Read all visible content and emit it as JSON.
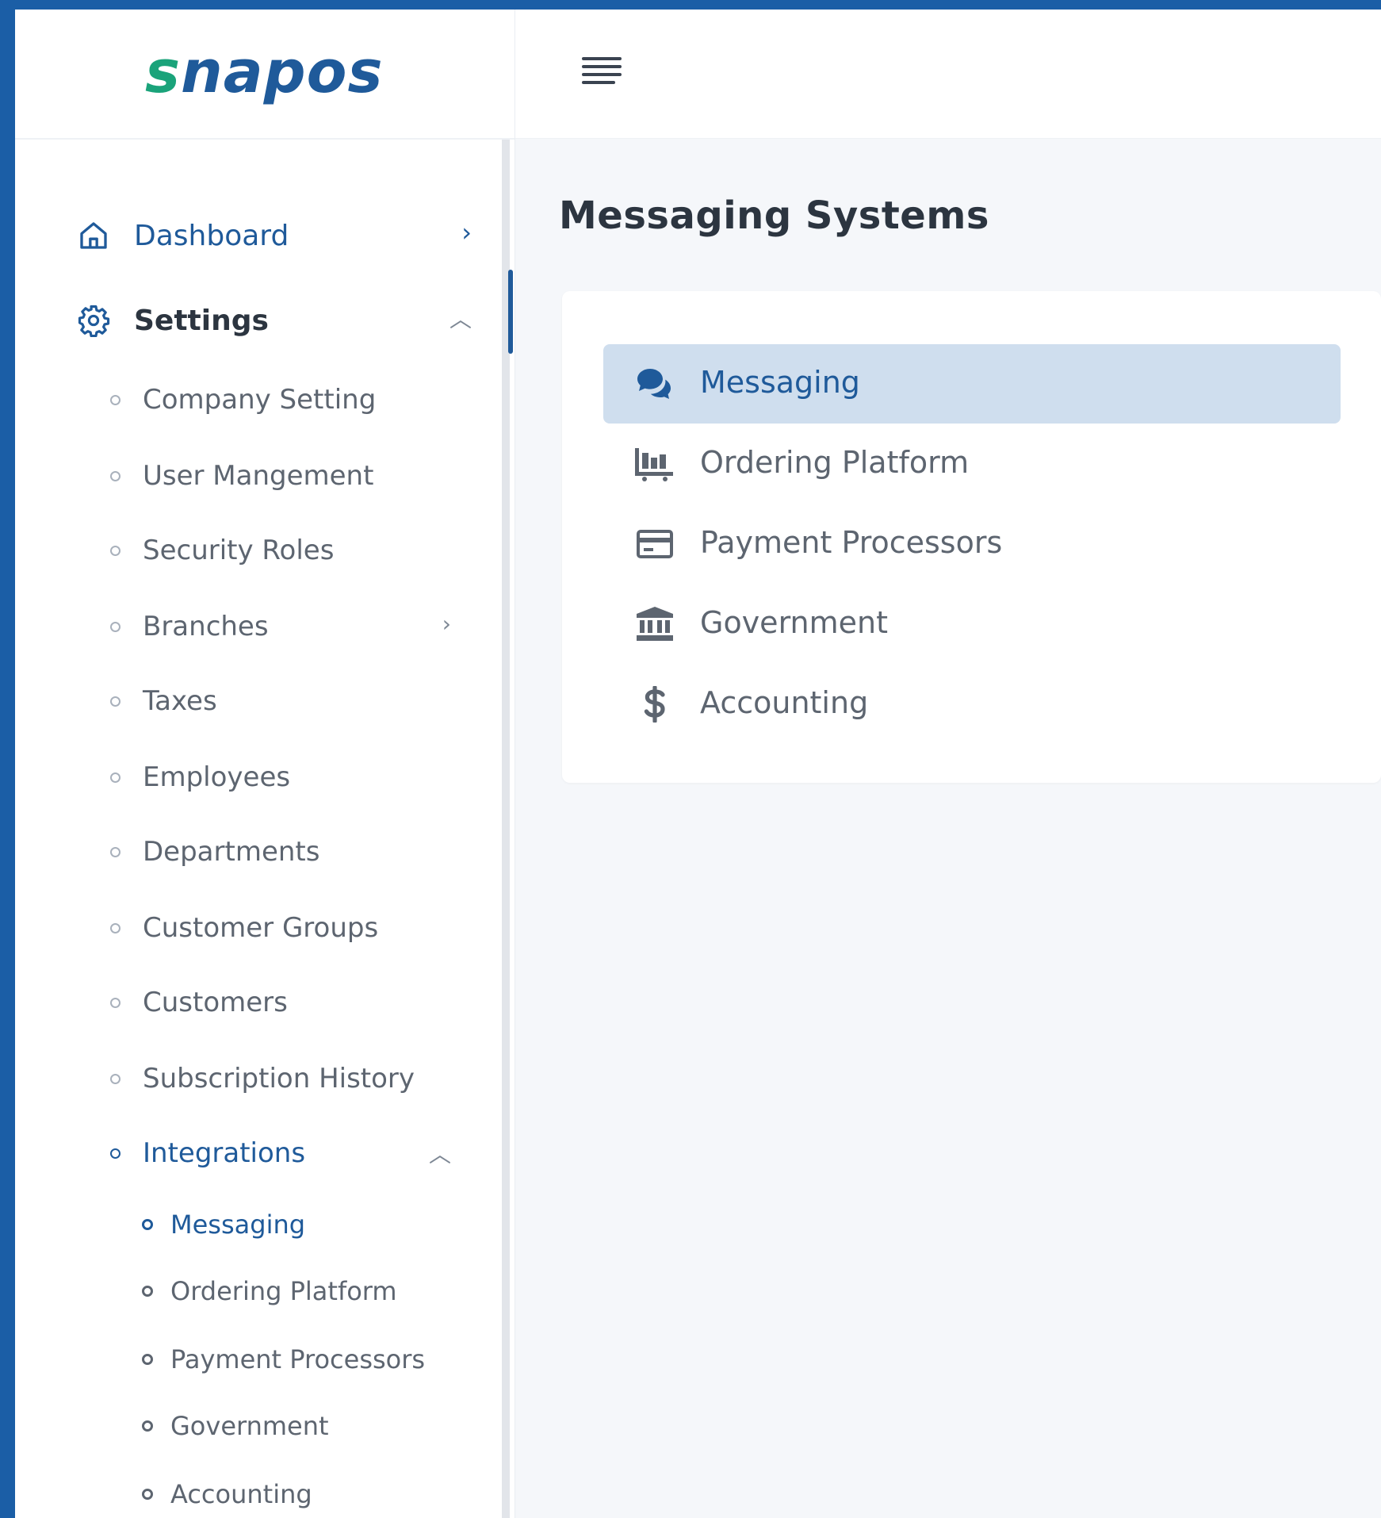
{
  "brand": {
    "logo_s": "s",
    "logo_rest": "napos"
  },
  "sidebar": {
    "dashboard": {
      "label": "Dashboard",
      "icon": "home-icon"
    },
    "settings": {
      "label": "Settings",
      "icon": "gear-icon"
    },
    "settings_items": [
      {
        "label": "Company Setting"
      },
      {
        "label": "User Mangement"
      },
      {
        "label": "Security Roles"
      },
      {
        "label": "Branches"
      },
      {
        "label": "Taxes"
      },
      {
        "label": "Employees"
      },
      {
        "label": "Departments"
      },
      {
        "label": "Customer Groups"
      },
      {
        "label": "Customers"
      },
      {
        "label": "Subscription History"
      },
      {
        "label": "Integrations"
      }
    ],
    "integrations_items": [
      {
        "label": "Messaging"
      },
      {
        "label": "Ordering Platform"
      },
      {
        "label": "Payment Processors"
      },
      {
        "label": "Government"
      },
      {
        "label": "Accounting"
      }
    ]
  },
  "main": {
    "title": "Messaging Systems",
    "menu": [
      {
        "label": "Messaging",
        "icon": "chat-icon"
      },
      {
        "label": "Ordering Platform",
        "icon": "cart-icon"
      },
      {
        "label": "Payment Processors",
        "icon": "credit-card-icon"
      },
      {
        "label": "Government",
        "icon": "bank-icon"
      },
      {
        "label": "Accounting",
        "icon": "dollar-icon"
      }
    ]
  },
  "colors": {
    "accent": "#1f5a9a",
    "brand_green": "#1aa37a",
    "active_bg": "#cfdeee",
    "frame": "#1b5ea6"
  }
}
